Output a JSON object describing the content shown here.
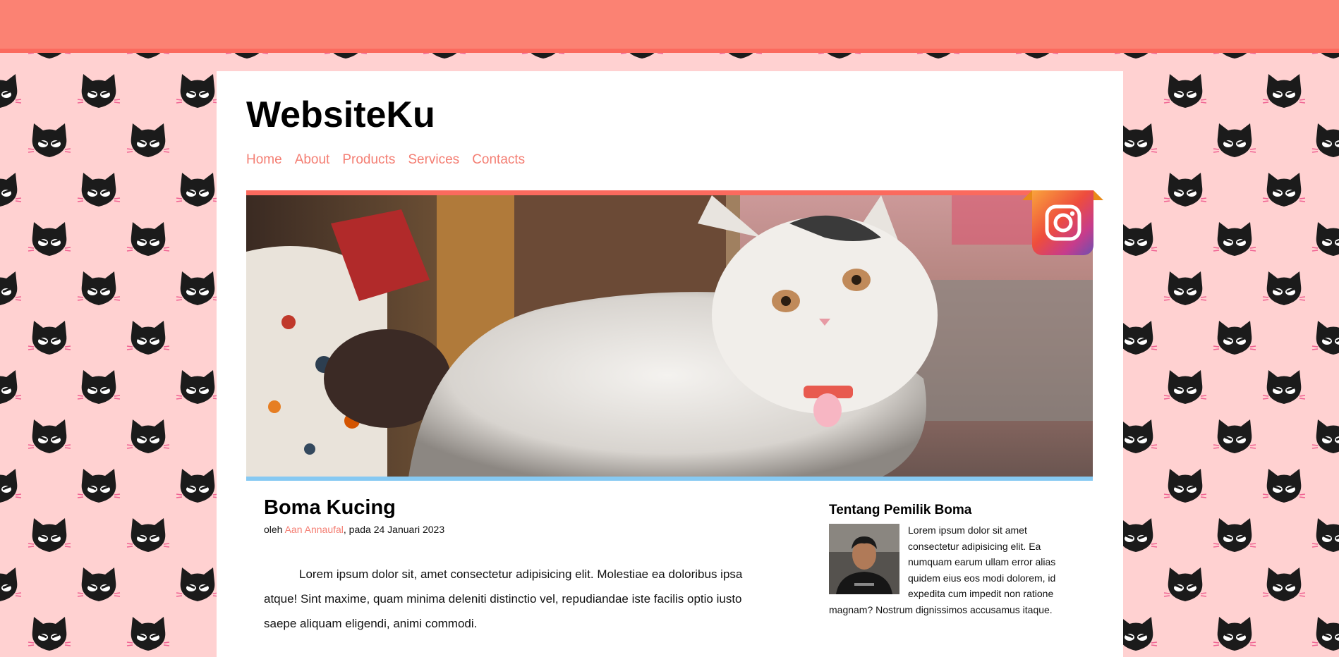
{
  "site": {
    "title": "WebsiteKu"
  },
  "nav": {
    "items": [
      "Home",
      "About",
      "Products",
      "Services",
      "Contacts"
    ]
  },
  "colors": {
    "accent": "#fb8273",
    "link": "#f47e73",
    "pattern_bg": "#ffd1d1",
    "hero_bottom": "#86c9f2"
  },
  "hero": {
    "image": "white cat photo",
    "badge_icon": "instagram-icon"
  },
  "article": {
    "title": "Boma Kucing",
    "byline_prefix": "oleh ",
    "author": "Aan Annaufal",
    "byline_suffix": ", pada 24 Januari 2023",
    "body": "Lorem ipsum dolor sit, amet consectetur adipisicing elit. Molestiae ea doloribus ipsa atque! Sint maxime, quam minima deleniti distinctio vel, repudiandae iste facilis optio iusto saepe aliquam eligendi, animi commodi."
  },
  "sidebar": {
    "title": "Tentang Pemilik Boma",
    "bio": "Lorem ipsum dolor sit amet consectetur adipisicing elit. Ea numquam earum ullam error alias quidem eius eos modi dolorem, id expedita cum impedit non ratione magnam? Nostrum dignissimos accusamus itaque."
  }
}
